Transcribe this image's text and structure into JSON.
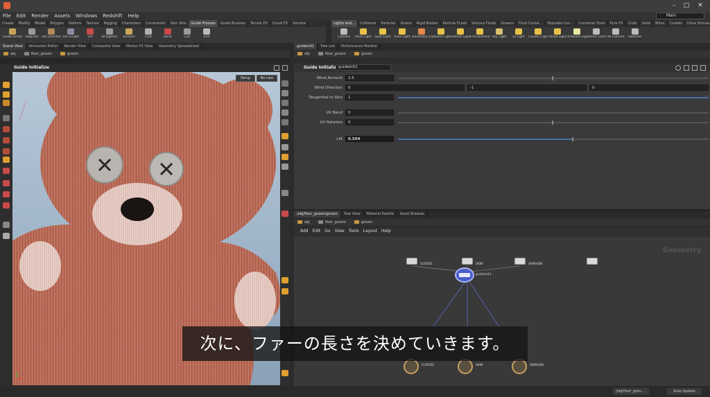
{
  "menu": [
    "File",
    "Edit",
    "Render",
    "Assets",
    "Windows",
    "Redshift",
    "Help"
  ],
  "desktop": "Main",
  "shelf_left": {
    "tabs": [
      "Create",
      "Modify",
      "Model",
      "Polygon",
      "Deform",
      "Texture",
      "Rigging",
      "Characters",
      "Constraints",
      "Hair Utils",
      "Guide Process",
      "Guide Brushes",
      "Terrain FX",
      "Cloud FX",
      "Volume"
    ],
    "active_tab": "Guide Process",
    "tools": [
      "Guide Groom",
      "Regrade",
      "Set Direction",
      "Set Length",
      "Lift",
      "Straighten",
      "Smooth",
      "Frizz",
      "Bend",
      "Curl",
      "Trim"
    ]
  },
  "shelf_right": {
    "tabs": [
      "Lights and...",
      "Collisions",
      "Particles",
      "Grains",
      "Rigid Bodies",
      "Particle Fluids",
      "Viscous Fluids",
      "Oceans",
      "Fluid Contai...",
      "Populate Con...",
      "Container Tools",
      "Pyro FX",
      "Cloth",
      "Solid",
      "Wires",
      "Crowds",
      "Drive Simula..."
    ],
    "active_tab": "Lights and...",
    "tools": [
      "Camera",
      "Point Light",
      "Spot Light",
      "Area Light",
      "Geometry Light",
      "Volume Light",
      "Distant Light",
      "Environment Light",
      "Sky Light",
      "GI Light",
      "Caustic Light",
      "Portal Light",
      "Ambient Light",
      "Stereo Camera",
      "VR Camera",
      "Switcher"
    ]
  },
  "left_pane": {
    "tabs": [
      "Scene View",
      "Animation Editor",
      "Render View",
      "Composite View",
      "Motion FX View",
      "Geometry Spreadsheet"
    ],
    "path": [
      "obj",
      "floor_groom",
      "groom"
    ],
    "title": "Guide Initialize",
    "persp": "Persp",
    "cam": "No cam"
  },
  "params_pane": {
    "tabs": [
      "guideinit1",
      "Tree List",
      "Performance Monitor"
    ],
    "path": [
      "obj",
      "floor_groom",
      "groom"
    ],
    "node_type": "Guide Initialize",
    "node_name": "guideinit1",
    "params": [
      {
        "label": "Wind Amount",
        "value": "2.5",
        "fill": 0.45
      },
      {
        "label": "Wind Direction",
        "value": "0",
        "v2": "-1",
        "v3": "0"
      },
      {
        "label": "Tangential to Skin",
        "value": "1",
        "fill": 1.0
      },
      {
        "label": "UV Bend",
        "value": "0",
        "fill": 0.0
      },
      {
        "label": "UV Rotation",
        "value": "0",
        "fill": 0.5
      },
      {
        "label": "Lift",
        "value": "0.504",
        "fill": 0.5
      }
    ]
  },
  "network_pane": {
    "tabs": [
      "/obj/floor_groom/groom",
      "Tree View",
      "Material Palette",
      "Asset Browser"
    ],
    "path": [
      "obj",
      "floor_groom",
      "groom"
    ],
    "menu": [
      "Add",
      "Edit",
      "Go",
      "View",
      "Tools",
      "Layout",
      "Help"
    ],
    "context_label": "Geometry",
    "nodes": [
      "GUIDES",
      "SKIN",
      "SKINVDB",
      "guideinit1",
      "CURVES",
      "SKIN",
      "SKINVDB"
    ]
  },
  "subtitle": "次に、ファーの長さを決めていきます。",
  "status": {
    "path": "/obj/floor_groo...",
    "update": "Auto Update"
  },
  "colors": {
    "accent": "#e0a030",
    "fur": "#b86a55",
    "sky": "#a9bccf"
  }
}
